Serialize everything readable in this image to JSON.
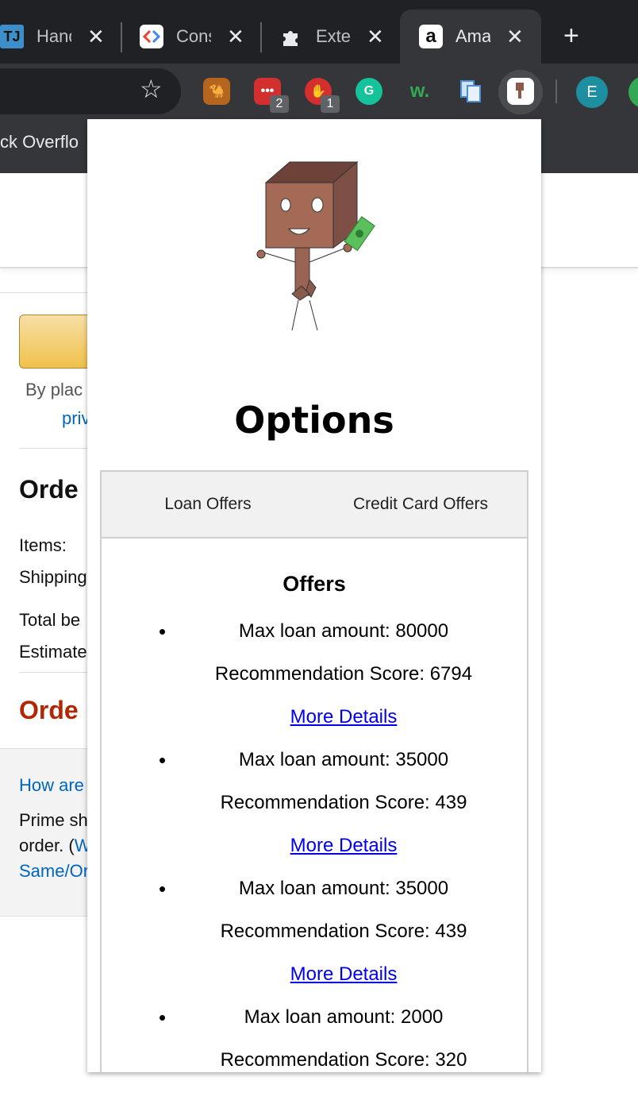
{
  "browser": {
    "tabs": [
      {
        "title": "Hand",
        "favicon": "tj-favicon"
      },
      {
        "title": "Cons",
        "favicon": "code-favicon"
      },
      {
        "title": "Exte",
        "favicon": "puzzle-favicon"
      },
      {
        "title": "Ama",
        "favicon": "amazon-favicon",
        "active": true
      }
    ],
    "new_tab_label": "+",
    "close_glyph": "✕",
    "extension_badges": [
      "2",
      "1"
    ],
    "profile_initial": "E",
    "bookmark_label": "ck Overflo"
  },
  "page": {
    "by_placing": "By plac",
    "privacy": "priv",
    "order_summary": "Orde",
    "items": "Items:",
    "shipping": "Shipping",
    "total_before": "Total be",
    "estimated": "Estimate",
    "order_total": "Orde",
    "how_are": "How are",
    "prime_sh": "Prime sh",
    "order_w_prefix": "order. (",
    "order_w_link": "W",
    "same_or": "Same/Or"
  },
  "popup": {
    "title": "Options",
    "tabs": [
      "Loan Offers",
      "Credit Card Offers"
    ],
    "offers_heading": "Offers",
    "more_label": "More Details",
    "offers": [
      {
        "amount_line": "Max loan amount: 80000",
        "score_line": "Recommendation Score: 6794"
      },
      {
        "amount_line": "Max loan amount: 35000",
        "score_line": "Recommendation Score: 439"
      },
      {
        "amount_line": "Max loan amount: 35000",
        "score_line": "Recommendation Score: 439"
      },
      {
        "amount_line": "Max loan amount: 2000",
        "score_line": "Recommendation Score: 320"
      }
    ]
  },
  "colors": {
    "chrome_dark": "#202124",
    "chrome_toolbar": "#35363a",
    "link_blue": "#0000ee",
    "amazon_link": "#0066c0",
    "amazon_red": "#b12704"
  }
}
